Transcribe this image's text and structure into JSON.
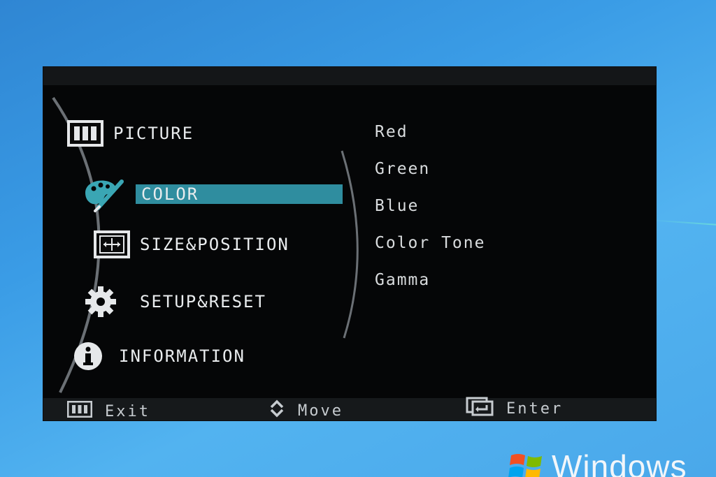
{
  "osd": {
    "main_menu": [
      {
        "id": "picture",
        "label": "PICTURE",
        "icon": "picture-icon",
        "selected": false
      },
      {
        "id": "color",
        "label": "COLOR",
        "icon": "palette-icon",
        "selected": true
      },
      {
        "id": "size",
        "label": "SIZE&POSITION",
        "icon": "size-position-icon",
        "selected": false
      },
      {
        "id": "setup",
        "label": "SETUP&RESET",
        "icon": "gear-icon",
        "selected": false
      },
      {
        "id": "info",
        "label": "INFORMATION",
        "icon": "info-icon",
        "selected": false
      }
    ],
    "submenu": [
      "Red",
      "Green",
      "Blue",
      "Color Tone",
      "Gamma"
    ],
    "footer": {
      "exit_label": "Exit",
      "move_label": "Move",
      "enter_label": "Enter"
    },
    "colors": {
      "background": "#050607",
      "highlight": "#2f8d9f",
      "accent_icon": "#3aa6b4",
      "text": "#e9ecee"
    }
  },
  "desktop": {
    "os_brand": "Windows"
  }
}
